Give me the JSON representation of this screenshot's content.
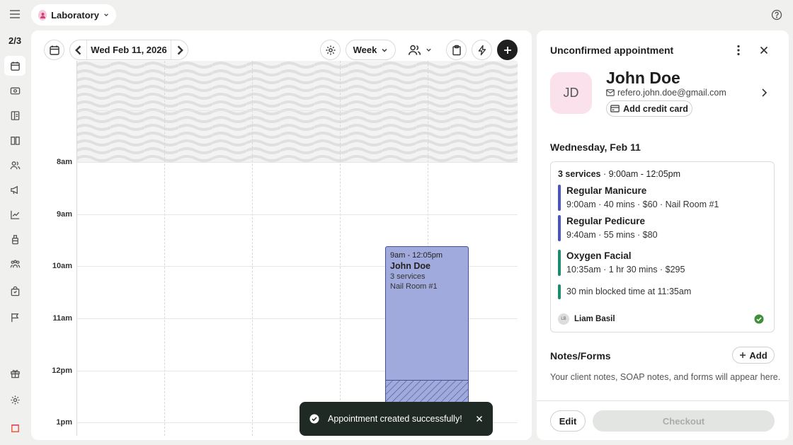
{
  "topbar": {
    "location": "Laboratory"
  },
  "rail": {
    "count": "2/3"
  },
  "calendar": {
    "date_label": "Wed Feb 11, 2026",
    "view_label": "Week",
    "hours": [
      "8am",
      "9am",
      "10am",
      "11am",
      "12pm",
      "1pm"
    ],
    "appointment": {
      "time": "9am - 12:05pm",
      "client": "John Doe",
      "services": "3 services",
      "room": "Nail Room #1"
    }
  },
  "toast": {
    "message": "Appointment created successfully!"
  },
  "panel": {
    "title": "Unconfirmed appointment",
    "client": {
      "initials": "JD",
      "name": "John Doe",
      "email": "refero.john.doe@gmail.com",
      "credit_button": "Add credit card"
    },
    "day": "Wednesday, Feb 11",
    "summary": {
      "count": "3 services",
      "range": " · 9:00am - 12:05pm"
    },
    "services": [
      {
        "name": "Regular Manicure",
        "meta": "9:00am · 40 mins · $60 · Nail Room #1",
        "color": "#4a55b5"
      },
      {
        "name": "Regular Pedicure",
        "meta": "9:40am · 55 mins · $80",
        "color": "#4a55b5"
      },
      {
        "name": "Oxygen Facial",
        "meta": "10:35am · 1 hr 30 mins · $295",
        "color": "#1e8a70"
      }
    ],
    "blocked": "30 min blocked time at 11:35am",
    "staff": {
      "initials": "LB",
      "name": "Liam Basil"
    },
    "notes_title": "Notes/Forms",
    "add_label": "Add",
    "notes_text": "Your client notes, SOAP notes, and forms will appear here.",
    "edit_label": "Edit",
    "checkout_label": "Checkout"
  }
}
